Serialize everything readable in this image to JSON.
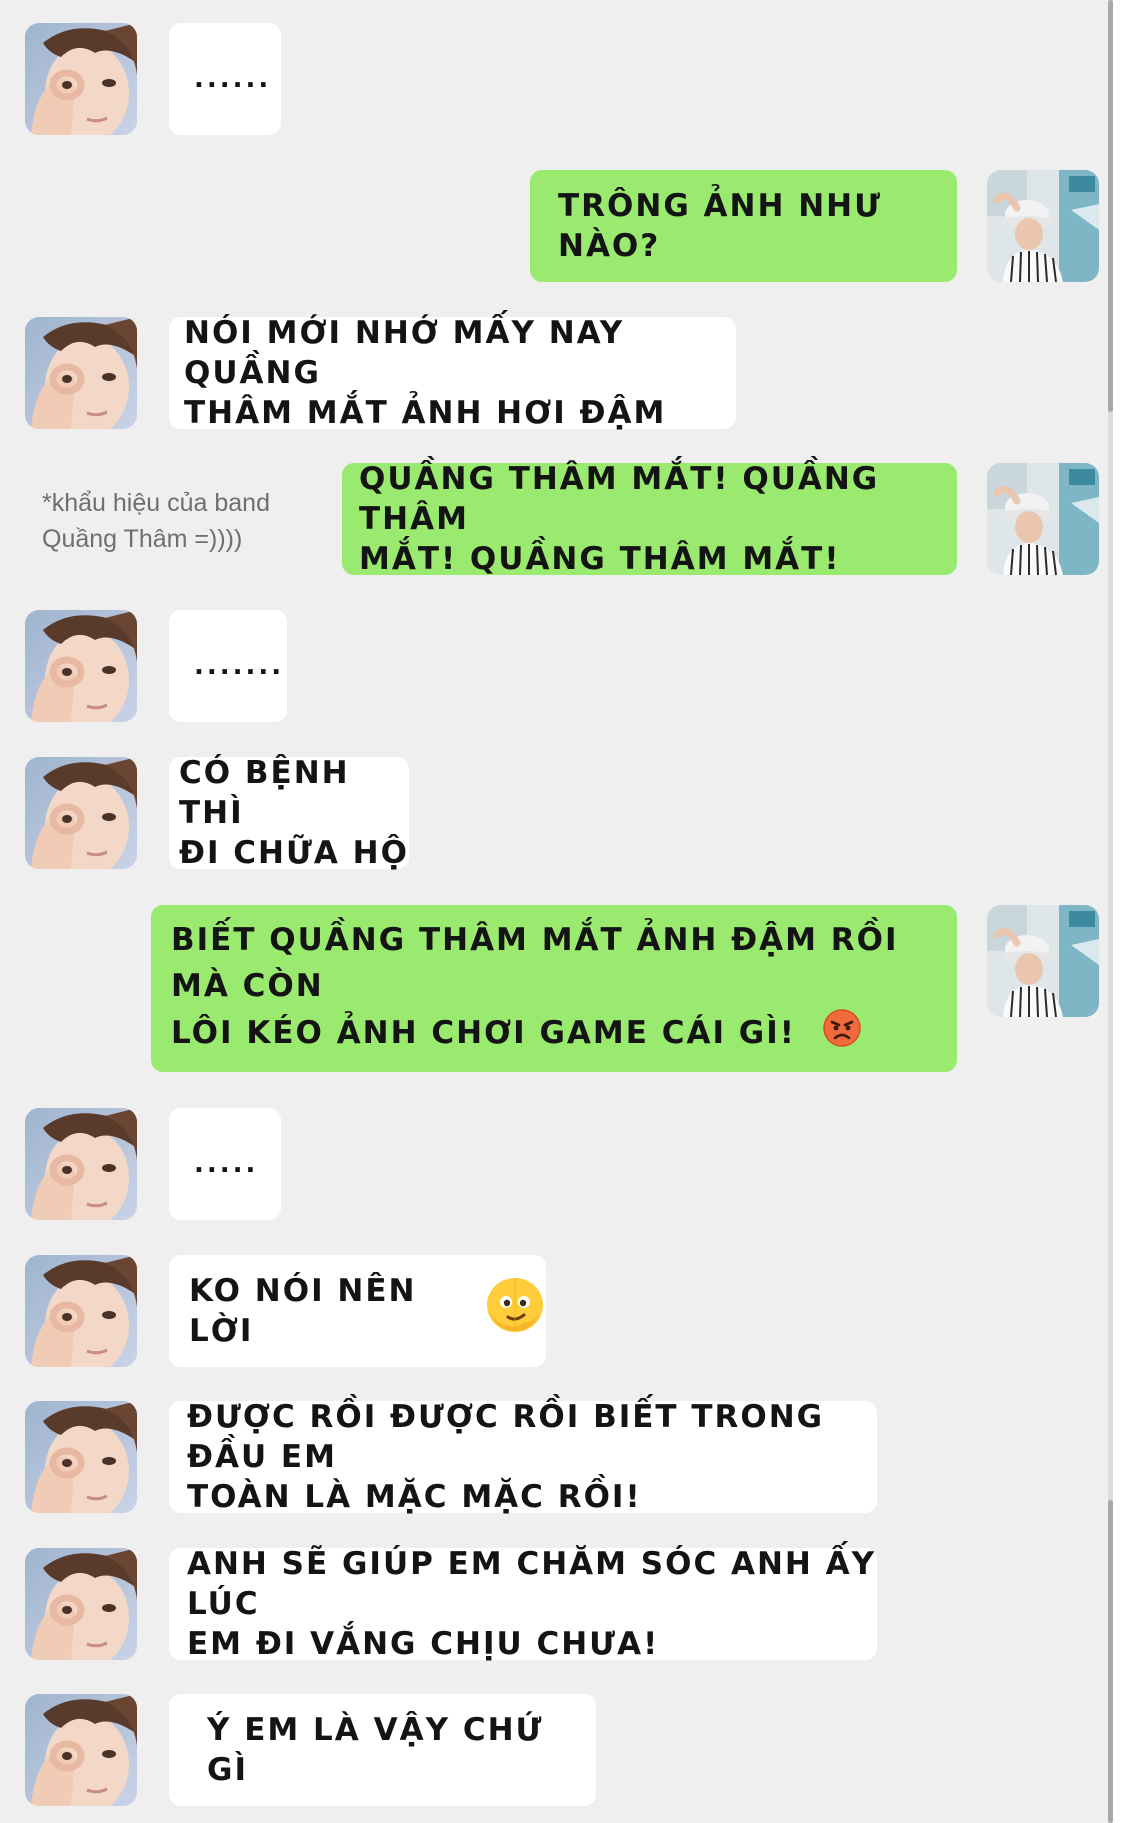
{
  "colors": {
    "background": "#efefef",
    "incoming_bubble": "#ffffff",
    "outgoing_bubble": "#9aea6f",
    "text": "#141414",
    "note_text": "#6f6f6f"
  },
  "avatars": {
    "contact": "contact-avatar-photo",
    "self": "self-avatar-photo"
  },
  "messages": [
    {
      "side": "in",
      "text": "......"
    },
    {
      "side": "out",
      "text": "TRÔNG ẢNH NHƯ NÀO?"
    },
    {
      "side": "in",
      "lines": [
        "NÓI MỚI NHỚ MẤY NAY QUẦNG",
        "THÂM MẮT ẢNH HƠI ĐẬM"
      ]
    },
    {
      "side": "out",
      "lines": [
        "QUẦNG THÂM MẮT! QUẦNG THÂM",
        "MẮT! QUẦNG THÂM MẮT!"
      ]
    },
    {
      "side": "in",
      "text": "......."
    },
    {
      "side": "in",
      "lines": [
        "CÓ BỆNH THÌ",
        "ĐI CHỮA HỘ"
      ]
    },
    {
      "side": "out",
      "lines": [
        "BIẾT QUẦNG THÂM MẮT ẢNH ĐẬM RỒI MÀ CÒN",
        "LÔI KÉO ẢNH CHƠI GAME CÁI GÌ!"
      ],
      "emoji": "angry-face-emoji"
    },
    {
      "side": "in",
      "text": "....."
    },
    {
      "side": "in",
      "text": "KO NÓI NÊN LỜI",
      "emoji": "melting-face-emoji"
    },
    {
      "side": "in",
      "lines": [
        "ĐƯỢC RỒI ĐƯỢC RỒI BIẾT TRONG ĐẦU EM",
        "TOÀN LÀ MẶC MẶC RỒI!"
      ]
    },
    {
      "side": "in",
      "lines": [
        "ANH SẼ GIÚP EM CHĂM SÓC ANH ẤY LÚC",
        "EM ĐI VẮNG CHỊU CHƯA!"
      ]
    },
    {
      "side": "in",
      "text": "Ý EM LÀ VẬY CHỨ GÌ"
    }
  ],
  "note": {
    "lines": [
      "*khẩu hiệu của band",
      "Quầng Thâm =))))"
    ]
  },
  "scrollbar": {
    "position_fraction": 0.86
  }
}
